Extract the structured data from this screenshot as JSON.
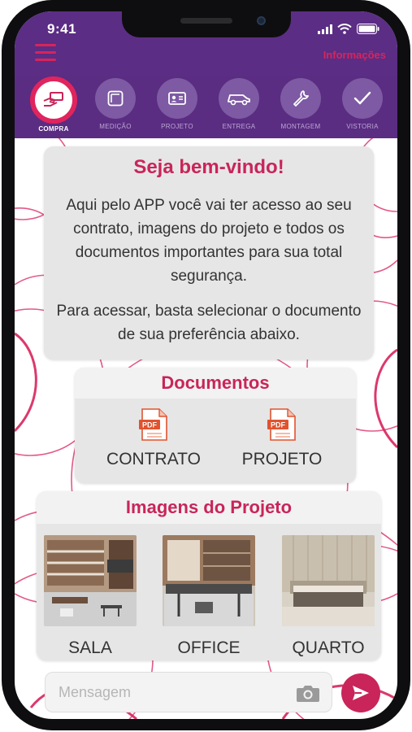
{
  "status": {
    "time": "9:41"
  },
  "header": {
    "info_label": "Informações",
    "steps": [
      {
        "label": "COMPRA",
        "icon": "hand-money-icon",
        "active": true
      },
      {
        "label": "MEDIÇÃO",
        "icon": "measure-icon",
        "active": false
      },
      {
        "label": "PROJETO",
        "icon": "id-card-icon",
        "active": false
      },
      {
        "label": "ENTREGA",
        "icon": "delivery-truck-icon",
        "active": false
      },
      {
        "label": "MONTAGEM",
        "icon": "wrench-icon",
        "active": false
      },
      {
        "label": "VISTORIA",
        "icon": "checkmark-icon",
        "active": false
      }
    ]
  },
  "welcome": {
    "title": "Seja bem-vindo!",
    "text1": "Aqui pelo APP você vai ter acesso ao seu contrato, imagens do projeto e todos os documentos importantes para sua total segurança.",
    "text2": "Para acessar, basta selecionar o documento de sua preferência abaixo."
  },
  "documents": {
    "title": "Documentos",
    "items": [
      {
        "label": "CONTRATO",
        "icon": "pdf-icon",
        "icon_text": "PDF"
      },
      {
        "label": "PROJETO",
        "icon": "pdf-icon",
        "icon_text": "PDF"
      }
    ]
  },
  "images": {
    "title": "Imagens do Projeto",
    "items": [
      {
        "label": "SALA"
      },
      {
        "label": "OFFICE"
      },
      {
        "label": "QUARTO"
      }
    ]
  },
  "message": {
    "placeholder": "Mensagem"
  },
  "colors": {
    "brand_purple": "#5b2d84",
    "accent_pink": "#c9255a",
    "card_gray": "#e6e6e6"
  }
}
